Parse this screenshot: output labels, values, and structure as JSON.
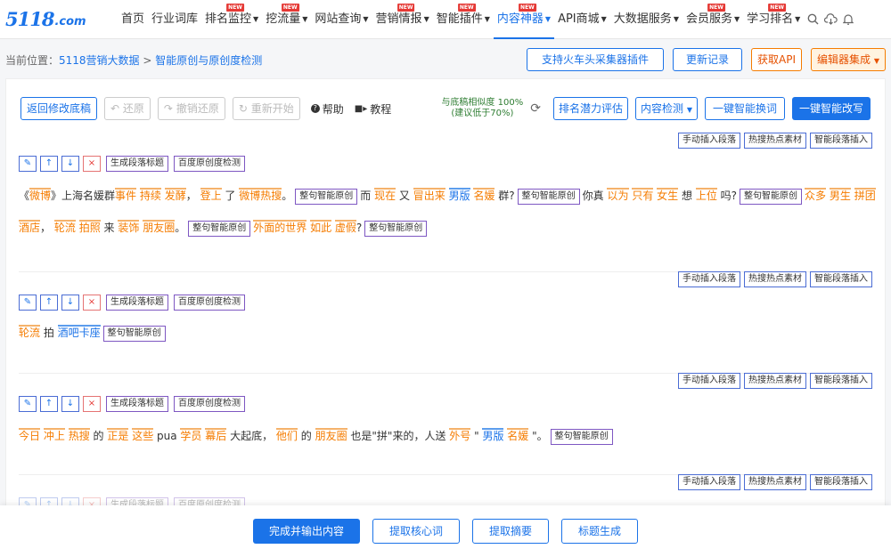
{
  "logo": {
    "text": "5118",
    "domain": ".com"
  },
  "nav": {
    "items": [
      {
        "label": "首页",
        "new": false,
        "caret": false,
        "active": false
      },
      {
        "label": "行业词库",
        "new": false,
        "caret": false,
        "active": false
      },
      {
        "label": "排名监控",
        "new": true,
        "caret": true,
        "active": false
      },
      {
        "label": "挖流量",
        "new": true,
        "caret": true,
        "active": false
      },
      {
        "label": "网站查询",
        "new": false,
        "caret": true,
        "active": false
      },
      {
        "label": "营销情报",
        "new": true,
        "caret": true,
        "active": false
      },
      {
        "label": "智能插件",
        "new": true,
        "caret": true,
        "active": false
      },
      {
        "label": "内容神器",
        "new": true,
        "caret": true,
        "active": true
      },
      {
        "label": "API商城",
        "new": false,
        "caret": true,
        "active": false
      },
      {
        "label": "大数据服务",
        "new": false,
        "caret": true,
        "active": false
      },
      {
        "label": "会员服务",
        "new": true,
        "caret": true,
        "active": false
      },
      {
        "label": "学习排名",
        "new": true,
        "caret": true,
        "active": false
      }
    ],
    "new_badge": "NEW",
    "caret": "▼"
  },
  "breadcrumb": {
    "prefix": "当前位置：",
    "item1": "5118营销大数据",
    "sep": " > ",
    "item2": "智能原创与原创度检测"
  },
  "top_buttons": {
    "plugin": "支持火车头采集器插件",
    "changelog": "更新记录",
    "api": "获取API",
    "editor": "编辑器集成"
  },
  "toolbar": {
    "back": "返回修改底稿",
    "undo": "还原",
    "redo": "撤销还原",
    "restart": "重新开始",
    "help": "帮助",
    "tutorial": "教程",
    "similarity_line1": "与底稿相似度 100%",
    "similarity_line2": "(建议低于70%)",
    "rank_eval": "排名潜力评估",
    "content_check": "内容检测",
    "one_click_replace": "一键智能换词",
    "one_click_rewrite": "一键智能改写"
  },
  "section_labels": {
    "manual_insert": "手动插入段落",
    "hot_material": "热搜热点素材",
    "smart_insert": "智能段落插入",
    "gen_title": "生成段落标题",
    "baidu_check": "百度原创度检测",
    "sentence_rewrite": "整句智能原创",
    "edit": "✎",
    "up": "↑",
    "down": "↓",
    "delete": "×"
  },
  "paragraphs": {
    "p1_line1": [
      {
        "t": "《",
        "h": ""
      },
      {
        "t": "微博",
        "h": "o"
      },
      {
        "t": "》上海名媛群",
        "h": ""
      },
      {
        "t": "事件",
        "h": "o"
      },
      {
        "t": " ",
        "h": ""
      },
      {
        "t": "持续",
        "h": "o"
      },
      {
        "t": " ",
        "h": ""
      },
      {
        "t": "发酵",
        "h": "o"
      },
      {
        "t": "， ",
        "h": ""
      },
      {
        "t": "登上",
        "h": "o"
      },
      {
        "t": " 了 ",
        "h": ""
      },
      {
        "t": "微博",
        "h": "o"
      },
      {
        "t": "热搜",
        "h": "o"
      },
      {
        "t": "。",
        "h": ""
      },
      {
        "t": "整句智能原创",
        "h": "tag"
      },
      {
        "t": "而 ",
        "h": ""
      },
      {
        "t": "现在",
        "h": "o"
      },
      {
        "t": " 又 ",
        "h": ""
      },
      {
        "t": "冒出来",
        "h": "o"
      },
      {
        "t": " ",
        "h": ""
      },
      {
        "t": "男版",
        "h": "b"
      },
      {
        "t": " ",
        "h": ""
      },
      {
        "t": "名媛",
        "h": "o"
      },
      {
        "t": " 群?",
        "h": ""
      },
      {
        "t": "整句智能原创",
        "h": "tag"
      },
      {
        "t": "你真 ",
        "h": ""
      },
      {
        "t": "以为",
        "h": "o"
      },
      {
        "t": " ",
        "h": ""
      },
      {
        "t": "只有",
        "h": "o"
      },
      {
        "t": " ",
        "h": ""
      },
      {
        "t": "女生",
        "h": "o"
      },
      {
        "t": " 想 ",
        "h": ""
      },
      {
        "t": "上位",
        "h": "o"
      },
      {
        "t": " 吗?",
        "h": ""
      },
      {
        "t": "整句智能原创",
        "h": "tag"
      },
      {
        "t": "众多",
        "h": "o"
      },
      {
        "t": " ",
        "h": ""
      },
      {
        "t": "男生",
        "h": "o"
      },
      {
        "t": " ",
        "h": ""
      },
      {
        "t": "拼团",
        "h": "o"
      }
    ],
    "p1_line2": [
      {
        "t": "酒店",
        "h": "o"
      },
      {
        "t": "， ",
        "h": ""
      },
      {
        "t": "轮流",
        "h": "o"
      },
      {
        "t": " ",
        "h": ""
      },
      {
        "t": "拍照",
        "h": "o"
      },
      {
        "t": " 来 ",
        "h": ""
      },
      {
        "t": "装饰",
        "h": "o"
      },
      {
        "t": " ",
        "h": ""
      },
      {
        "t": "朋友圈",
        "h": "o"
      },
      {
        "t": "。",
        "h": ""
      },
      {
        "t": "整句智能原创",
        "h": "tag"
      },
      {
        "t": "外面的世界",
        "h": "o"
      },
      {
        "t": " ",
        "h": ""
      },
      {
        "t": "如此",
        "h": "o"
      },
      {
        "t": " ",
        "h": ""
      },
      {
        "t": "虚假",
        "h": "o"
      },
      {
        "t": "?",
        "h": ""
      },
      {
        "t": "整句智能原创",
        "h": "tag"
      }
    ],
    "p2_line1": [
      {
        "t": "轮流",
        "h": "o"
      },
      {
        "t": " 拍 ",
        "h": ""
      },
      {
        "t": "酒吧卡座",
        "h": "b"
      },
      {
        "t": "整句智能原创",
        "h": "tag"
      }
    ],
    "p3_line1": [
      {
        "t": "今日",
        "h": "o"
      },
      {
        "t": " ",
        "h": ""
      },
      {
        "t": "冲上",
        "h": "o"
      },
      {
        "t": " ",
        "h": ""
      },
      {
        "t": "热搜",
        "h": "o"
      },
      {
        "t": " 的 ",
        "h": ""
      },
      {
        "t": "正是",
        "h": "o"
      },
      {
        "t": " ",
        "h": ""
      },
      {
        "t": "这些",
        "h": "o"
      },
      {
        "t": " pua ",
        "h": ""
      },
      {
        "t": "学员",
        "h": "o"
      },
      {
        "t": " ",
        "h": ""
      },
      {
        "t": "幕后",
        "h": "o"
      },
      {
        "t": " 大起底， ",
        "h": ""
      },
      {
        "t": "他们",
        "h": "o"
      },
      {
        "t": " 的 ",
        "h": ""
      },
      {
        "t": "朋友圈",
        "h": "o"
      },
      {
        "t": " 也是\"拼\"来的，人送 ",
        "h": ""
      },
      {
        "t": "外号",
        "h": "o"
      },
      {
        "t": " \" ",
        "h": ""
      },
      {
        "t": "男版",
        "h": "b"
      },
      {
        "t": " ",
        "h": ""
      },
      {
        "t": "名媛",
        "h": "o"
      },
      {
        "t": " \"。",
        "h": ""
      },
      {
        "t": "整句智能原创",
        "h": "tag"
      }
    ]
  },
  "bottom": {
    "finish": "完成并输出内容",
    "core_words": "提取核心词",
    "summary": "提取摘要",
    "title_gen": "标题生成"
  }
}
